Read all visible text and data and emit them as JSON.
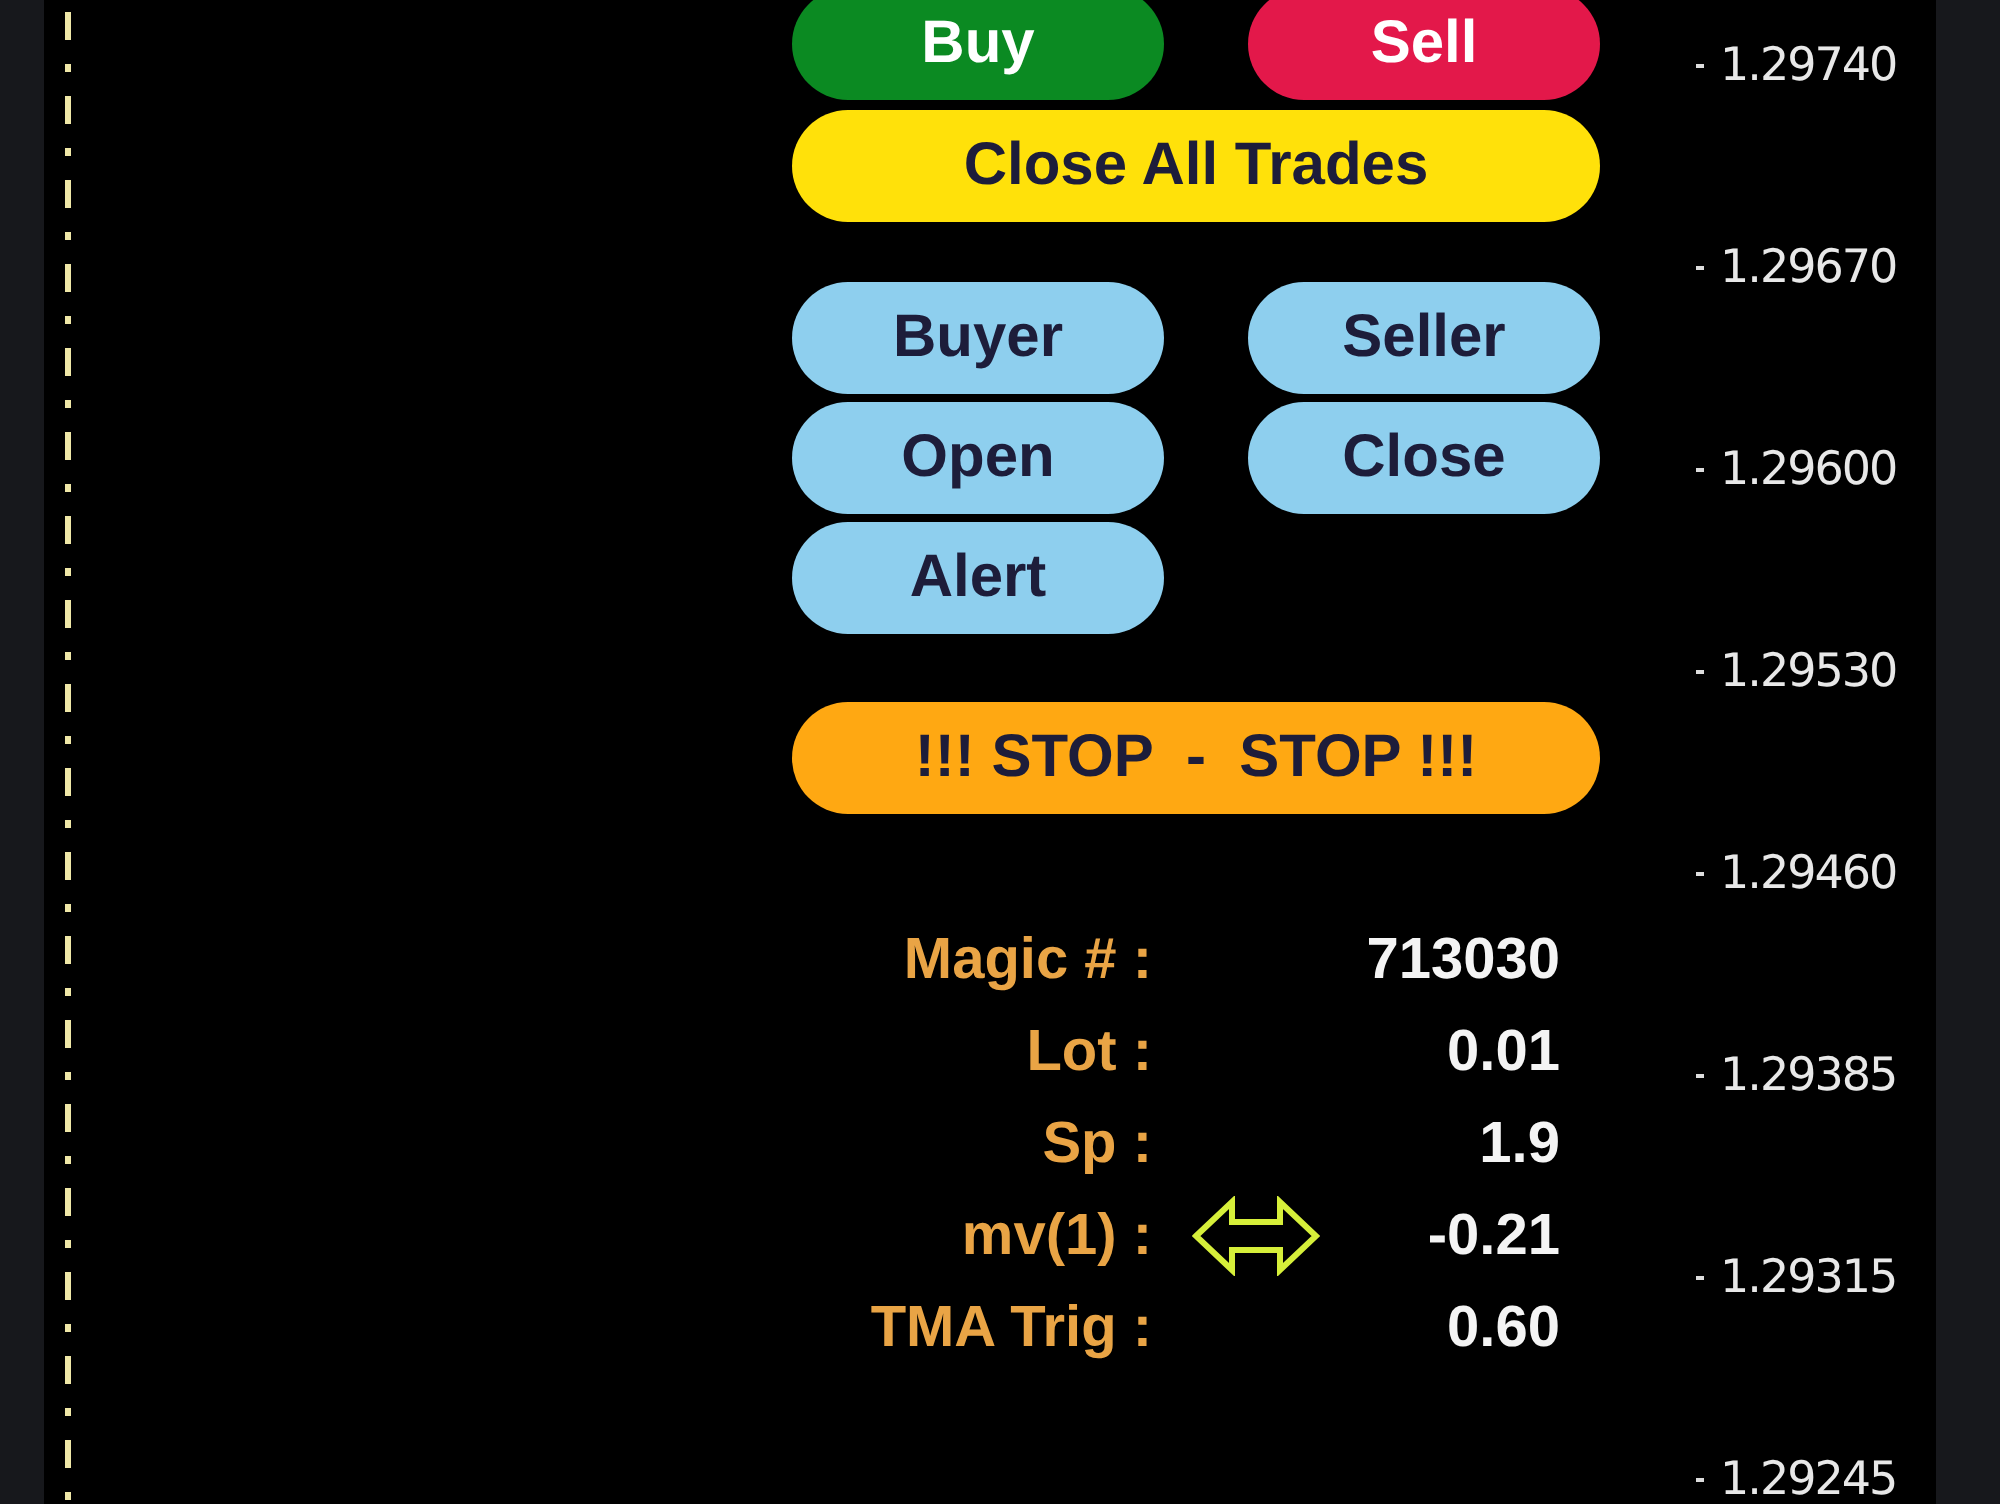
{
  "trade_buttons": [
    {
      "label": "Buy",
      "kind": "buy"
    },
    {
      "label": "Sell",
      "kind": "sell"
    }
  ],
  "close_all_button": {
    "label": "Close All Trades",
    "kind": "close_all"
  },
  "tool_buttons": [
    {
      "label": "Buyer",
      "kind": "tool"
    },
    {
      "label": "Seller",
      "kind": "tool"
    },
    {
      "label": "Open",
      "kind": "tool"
    },
    {
      "label": "Close",
      "kind": "tool"
    },
    {
      "label": "Alert",
      "kind": "tool"
    }
  ],
  "stop_button": {
    "label": "!!! STOP  -  STOP !!!",
    "kind": "stop"
  },
  "info_rows": [
    {
      "label": "Magic # :",
      "value": "713030",
      "arrow": false
    },
    {
      "label": "Lot :",
      "value": "0.01",
      "arrow": false
    },
    {
      "label": "Sp :",
      "value": "1.9",
      "arrow": false
    },
    {
      "label": "mv(1) :",
      "value": "-0.21",
      "arrow": true
    },
    {
      "label": "TMA Trig :",
      "value": "0.60",
      "arrow": false
    }
  ],
  "price_axis": [
    "1.29740",
    "1.29670",
    "1.29600",
    "1.29530",
    "1.29460",
    "1.29385",
    "1.29315",
    "1.29245"
  ]
}
